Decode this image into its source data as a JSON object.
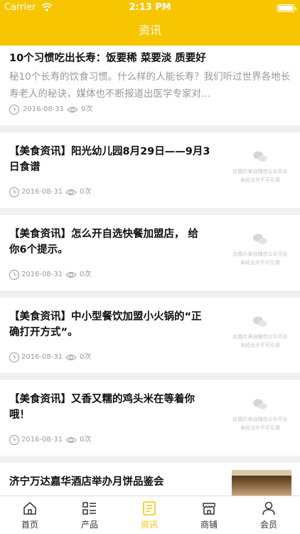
{
  "status_bar": {
    "carrier": "Carrier",
    "time": "2:13 PM"
  },
  "nav": {
    "title": "资讯"
  },
  "colors": {
    "brand": "#f7c600",
    "active_tab": "#f7c600",
    "meta_gray": "#9a9a9a"
  },
  "placeholder_image": {
    "line1": "此图片来自微信公众平台",
    "line2": "未经允许不可引用"
  },
  "articles": [
    {
      "title": "10个习惯吃出长寿：饭要稀 菜要淡 质要好",
      "summary": "秘10个长寿的饮食习惯。什么样的人能长寿？我们听过世界各地长寿老人的秘诀，媒体也不断报道出医学专家对...",
      "date": "2016-08-31",
      "views": "0次"
    },
    {
      "title_line1": "【美食资讯】阳光幼儿园8月29日——9月3",
      "title_line2": "日食谱",
      "date": "2016-08-31",
      "views": "0次"
    },
    {
      "title_line1": "【美食资讯】怎么开自选快餐加盟店， 给",
      "title_line2": "你6个提示。",
      "date": "2016-08-31",
      "views": "0次"
    },
    {
      "title_line1": "【美食资讯】中小型餐饮加盟小火锅的“正",
      "title_line2": "确打开方式”。",
      "date": "2016-08-31",
      "views": "0次"
    },
    {
      "title_line1": "【美食资讯】又香又糯的鸡头米在等着你",
      "title_line2": "哦！",
      "date": "2016-08-31",
      "views": "0次"
    },
    {
      "title": "济宁万达嘉华酒店举办月饼品鉴会"
    }
  ],
  "tabs": [
    {
      "label": "首页",
      "icon": "home-icon"
    },
    {
      "label": "产品",
      "icon": "product-grid-icon"
    },
    {
      "label": "资讯",
      "icon": "news-icon",
      "active": true
    },
    {
      "label": "商铺",
      "icon": "shop-icon"
    },
    {
      "label": "会员",
      "icon": "member-icon"
    }
  ]
}
